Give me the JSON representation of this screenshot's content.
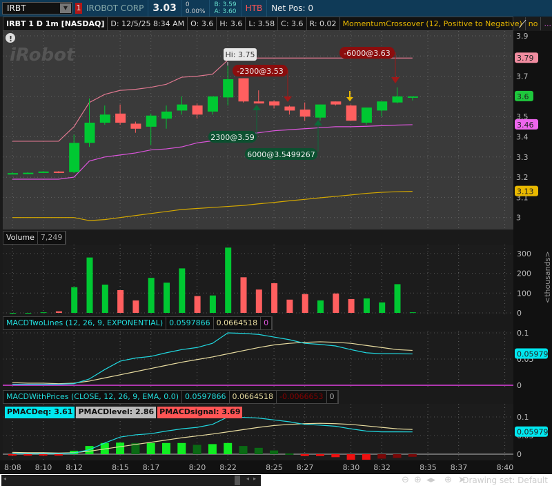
{
  "topbar": {
    "symbol": "IRBT",
    "alert_count": "1",
    "company": "IROBOT CORP",
    "last": "3.03",
    "change": "0",
    "change_pct": "0.00%",
    "bid": "B: 3.59",
    "ask": "A: 3.60",
    "htb": "HTB",
    "net_pos": "Net Pos: 0"
  },
  "infobar": {
    "title": "IRBT 1 D 1m [NASDAQ]",
    "date": "D: 12/5/25 8:34 AM",
    "open": "O: 3.6",
    "high": "H: 3.6",
    "low": "L: 3.58",
    "close": "C: 3.6",
    "range": "R: 0.02",
    "study": "MomentumCrossover (12, Positive to Negative)",
    "study_value": "no",
    "more": "..."
  },
  "colors": {
    "up": "#00c832",
    "down": "#ff5f5f",
    "upper_band": "#e07890",
    "lower_band": "#dd55dd",
    "gold": "#d4a800",
    "macd": "#20d8e0",
    "signal": "#e8dca0"
  },
  "watermark": "iRobot",
  "annotations": {
    "hi": "Hi: 3.75",
    "sell1": "-2300@3.53",
    "sell2": "-6000@3.63",
    "buy1": "2300@3.59",
    "buy2": "6000@3.5499267"
  },
  "price_axis": {
    "ticks": [
      "3.9",
      "3.8",
      "3.7",
      "3.6",
      "3.5",
      "3.4",
      "3.3",
      "3.2",
      "3.1",
      "3"
    ],
    "badges": [
      {
        "label": "3.79",
        "value": 3.79,
        "color": "#f08ca0"
      },
      {
        "label": "3.6",
        "value": 3.6,
        "color": "#1ec83c"
      },
      {
        "label": "3.46",
        "value": 3.46,
        "color": "#ee66ee"
      },
      {
        "label": "3.13",
        "value": 3.13,
        "color": "#e8b800"
      }
    ]
  },
  "volume": {
    "label": "Volume",
    "value": "7,249",
    "ticks": [
      "300",
      "200",
      "100",
      "0"
    ],
    "unit": "<thousands>"
  },
  "macd1": {
    "label": "MACDTwoLines (12, 26, 9, EXPONENTIAL)",
    "v1": "0.0597866",
    "v2": "0.0664518",
    "v3": "0",
    "ticks": [
      "0.1",
      "0.05",
      "0"
    ],
    "badge": "0.05979"
  },
  "macd2": {
    "label": "MACDWithPrices (CLOSE, 12, 26, 9, EMA, 0.0)",
    "v1": "0.0597866",
    "v2": "0.0664518",
    "v3": "-0.0066653",
    "v4": "0",
    "ticks": [
      "0.1",
      "0.05",
      "0"
    ],
    "badge": "0.05979",
    "pmacdeq": "PMACDeq: 3.61",
    "pmacdlevel": "PMACDlevel: 2.86",
    "pmacdsignal": "PMACDsignal: 3.69"
  },
  "time_labels": [
    {
      "t": "8:08",
      "i": 0
    },
    {
      "t": "8:10",
      "i": 2
    },
    {
      "t": "8:12",
      "i": 4
    },
    {
      "t": "8:15",
      "i": 7
    },
    {
      "t": "8:17",
      "i": 9
    },
    {
      "t": "8:20",
      "i": 12
    },
    {
      "t": "8:22",
      "i": 14
    },
    {
      "t": "8:25",
      "i": 17
    },
    {
      "t": "8:27",
      "i": 19
    },
    {
      "t": "8:30",
      "i": 22
    },
    {
      "t": "8:32",
      "i": 24
    },
    {
      "t": "8:35",
      "i": 27
    },
    {
      "t": "8:37",
      "i": 29
    },
    {
      "t": "8:40",
      "i": 32
    }
  ],
  "bottom": {
    "drawing_set": "Drawing set: Default"
  },
  "chart_data": {
    "type": "candlestick",
    "ylim": [
      2.95,
      3.92
    ],
    "ohlc": [
      [
        3.22,
        3.225,
        3.215,
        3.22
      ],
      [
        3.22,
        3.225,
        3.215,
        3.222
      ],
      [
        3.222,
        3.23,
        3.22,
        3.228
      ],
      [
        3.228,
        3.23,
        3.22,
        3.225
      ],
      [
        3.225,
        3.41,
        3.22,
        3.37
      ],
      [
        3.37,
        3.59,
        3.35,
        3.47
      ],
      [
        3.47,
        3.555,
        3.46,
        3.51
      ],
      [
        3.515,
        3.56,
        3.46,
        3.47
      ],
      [
        3.465,
        3.475,
        3.42,
        3.44
      ],
      [
        3.45,
        3.515,
        3.36,
        3.505
      ],
      [
        3.49,
        3.555,
        3.44,
        3.525
      ],
      [
        3.53,
        3.6,
        3.51,
        3.56
      ],
      [
        3.555,
        3.565,
        3.49,
        3.51
      ],
      [
        3.525,
        3.6,
        3.51,
        3.6
      ],
      [
        3.595,
        3.75,
        3.555,
        3.685
      ],
      [
        3.69,
        3.69,
        3.57,
        3.575
      ],
      [
        3.575,
        3.63,
        3.565,
        3.565
      ],
      [
        3.575,
        3.58,
        3.54,
        3.555
      ],
      [
        3.55,
        3.555,
        3.51,
        3.53
      ],
      [
        3.535,
        3.57,
        3.48,
        3.5
      ],
      [
        3.495,
        3.56,
        3.48,
        3.56
      ],
      [
        3.575,
        3.575,
        3.555,
        3.56
      ],
      [
        3.555,
        3.56,
        3.48,
        3.48
      ],
      [
        3.47,
        3.545,
        3.46,
        3.545
      ],
      [
        3.53,
        3.575,
        3.5,
        3.575
      ],
      [
        3.57,
        3.645,
        3.565,
        3.6
      ],
      [
        3.6,
        3.6,
        3.58,
        3.6
      ]
    ],
    "upper_band": [
      3.378,
      3.378,
      3.378,
      3.378,
      3.45,
      3.57,
      3.61,
      3.63,
      3.635,
      3.645,
      3.66,
      3.695,
      3.7,
      3.71,
      3.78,
      3.79,
      3.79,
      3.79,
      3.79,
      3.79,
      3.79,
      3.79,
      3.79,
      3.79,
      3.79,
      3.79,
      3.79
    ],
    "lower_band": [
      3.19,
      3.19,
      3.19,
      3.19,
      3.2,
      3.28,
      3.3,
      3.31,
      3.32,
      3.335,
      3.34,
      3.35,
      3.37,
      3.38,
      3.385,
      3.41,
      3.42,
      3.43,
      3.435,
      3.44,
      3.445,
      3.45,
      3.45,
      3.452,
      3.455,
      3.458,
      3.46
    ],
    "gold_line": [
      3.0,
      3.0,
      3.0,
      3.0,
      3.0,
      2.985,
      2.99,
      3.0,
      3.01,
      3.02,
      3.03,
      3.04,
      3.045,
      3.05,
      3.055,
      3.06,
      3.068,
      3.075,
      3.083,
      3.09,
      3.098,
      3.105,
      3.112,
      3.12,
      3.125,
      3.128,
      3.13
    ],
    "volume_k": [
      0,
      0,
      3,
      8,
      130,
      280,
      143,
      115,
      63,
      177,
      153,
      225,
      85,
      88,
      330,
      180,
      118,
      150,
      67,
      95,
      63,
      98,
      70,
      73,
      53,
      145,
      3
    ],
    "macd": [
      0.002,
      0.002,
      0.002,
      0.002,
      0.003,
      0.012,
      0.03,
      0.046,
      0.052,
      0.055,
      0.062,
      0.068,
      0.072,
      0.08,
      0.1,
      0.099,
      0.097,
      0.092,
      0.087,
      0.08,
      0.078,
      0.075,
      0.068,
      0.062,
      0.06,
      0.06,
      0.0598
    ],
    "signal": [
      0.005,
      0.004,
      0.004,
      0.003,
      0.004,
      0.008,
      0.014,
      0.02,
      0.026,
      0.032,
      0.038,
      0.044,
      0.049,
      0.054,
      0.06,
      0.066,
      0.072,
      0.077,
      0.08,
      0.082,
      0.083,
      0.082,
      0.08,
      0.076,
      0.072,
      0.068,
      0.0665
    ],
    "histogram": [
      -0.002,
      -0.002,
      -0.002,
      -0.002,
      0.009,
      0.022,
      0.03,
      0.031,
      0.03,
      0.03,
      0.03,
      0.03,
      0.025,
      0.027,
      0.03,
      0.022,
      0.017,
      0.01,
      0.002,
      -0.005,
      -0.005,
      -0.008,
      -0.015,
      -0.015,
      -0.012,
      -0.01,
      -0.007
    ]
  }
}
